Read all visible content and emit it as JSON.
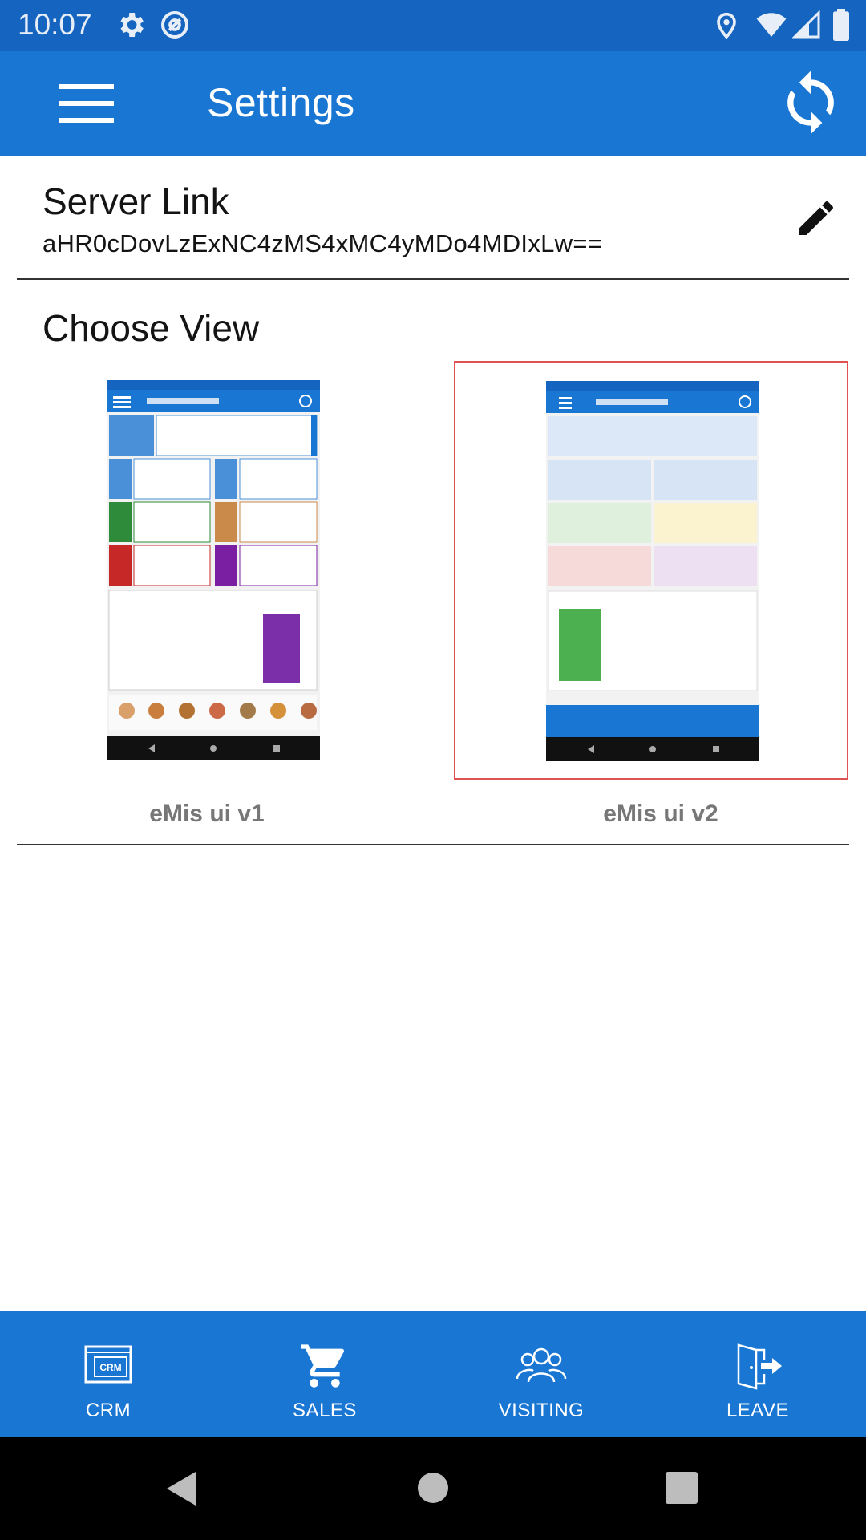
{
  "status_bar": {
    "time": "10:07",
    "icons": [
      "gear-icon",
      "at-sign-icon",
      "location-icon",
      "wifi-icon",
      "signal-icon",
      "battery-icon"
    ]
  },
  "app_bar": {
    "title": "Settings",
    "menu_icon": "hamburger-icon",
    "refresh_icon": "sync-icon"
  },
  "server": {
    "label": "Server Link",
    "value": "aHR0cDovLzExNC4zMS4xMC4yMDo4MDIxLw==",
    "edit_icon": "pencil-icon"
  },
  "choose_view": {
    "label": "Choose View",
    "options": [
      {
        "label": "eMis ui v1",
        "selected": false
      },
      {
        "label": "eMis ui v2",
        "selected": true
      }
    ],
    "selected_border_color": "#e05252"
  },
  "bottom_nav": [
    {
      "label": "CRM",
      "icon": "crm-icon"
    },
    {
      "label": "SALES",
      "icon": "cart-icon"
    },
    {
      "label": "VISITING",
      "icon": "people-icon"
    },
    {
      "label": "LEAVE",
      "icon": "exit-door-icon"
    }
  ],
  "colors": {
    "status_bar": "#1565c0",
    "app_bar": "#1976d2",
    "bottom_nav": "#1976d2"
  }
}
